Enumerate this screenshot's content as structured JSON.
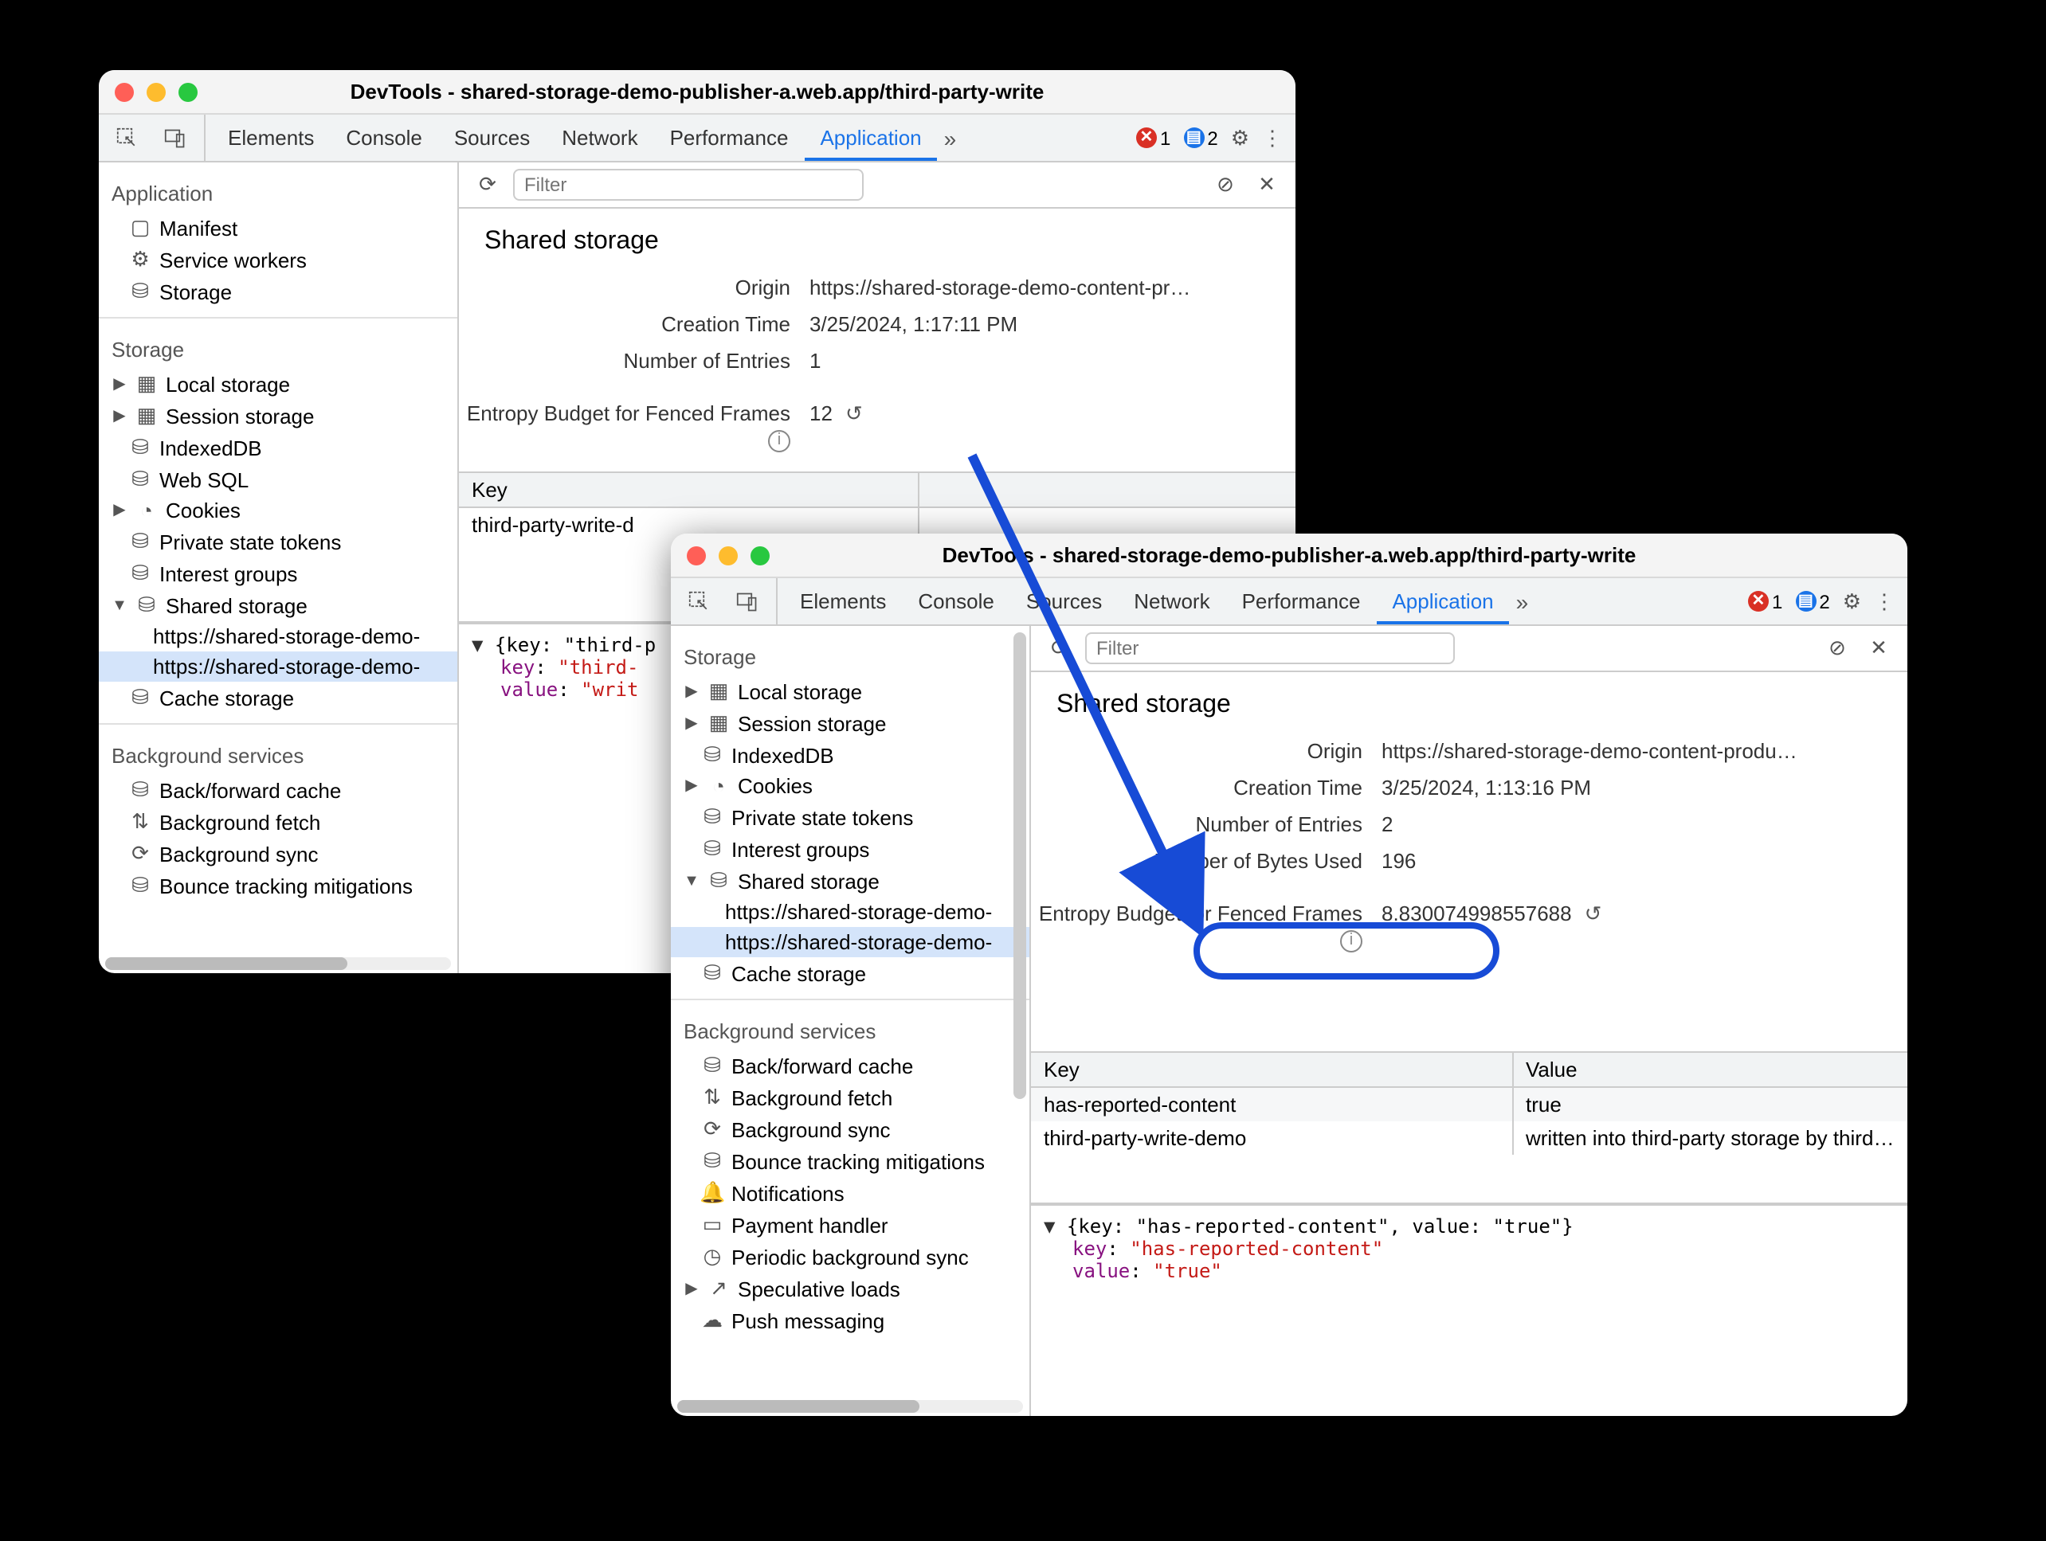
{
  "shared": {
    "title_prefix": "DevTools - ",
    "title_url": "shared-storage-demo-publisher-a.web.app/third-party-write",
    "tabs": {
      "elements": "Elements",
      "console": "Console",
      "sources": "Sources",
      "network": "Network",
      "performance": "Performance",
      "application": "Application"
    },
    "filter_placeholder": "Filter",
    "heading": "Shared storage",
    "origin_label": "Origin",
    "origin_value": "https://shared-storage-demo-content-pr…",
    "origin_value_b": "https://shared-storage-demo-content-produ…",
    "creation_label": "Creation Time",
    "entries_label": "Number of Entries",
    "bytes_label": "Number of Bytes Used",
    "entropy_label": "Entropy Budget for Fenced Frames",
    "table_key": "Key",
    "table_value": "Value",
    "errors": "1",
    "infos": "2",
    "sidebar": {
      "application": "Application",
      "manifest": "Manifest",
      "service_workers": "Service workers",
      "storage": "Storage",
      "storage_section": "Storage",
      "local": "Local storage",
      "session": "Session storage",
      "indexed": "IndexedDB",
      "websql": "Web SQL",
      "cookies": "Cookies",
      "pst": "Private state tokens",
      "ig": "Interest groups",
      "shared": "Shared storage",
      "shared_origin": "https://shared-storage-demo-",
      "cache": "Cache storage",
      "bg_section": "Background services",
      "bf": "Back/forward cache",
      "bgfetch": "Background fetch",
      "bgsync": "Background sync",
      "bounce": "Bounce tracking mitigations",
      "notif": "Notifications",
      "payment": "Payment handler",
      "periodic": "Periodic background sync",
      "spec": "Speculative loads",
      "push": "Push messaging"
    }
  },
  "windowA": {
    "creation_value": "3/25/2024, 1:17:11 PM",
    "entries_value": "1",
    "entropy_value": "12",
    "table_rows": [
      {
        "key": "third-party-write-d"
      }
    ],
    "obj_head": "{key: \"third-p",
    "obj_key_lbl": "key",
    "obj_key_val": "\"third-",
    "obj_val_lbl": "value",
    "obj_val_val": "\"writ"
  },
  "windowB": {
    "creation_value": "3/25/2024, 1:13:16 PM",
    "entries_value": "2",
    "bytes_value": "196",
    "entropy_value": "8.830074998557688",
    "table_rows": [
      {
        "key": "has-reported-content",
        "value": "true"
      },
      {
        "key": "third-party-write-demo",
        "value": "written into third-party storage by third-…"
      }
    ],
    "obj_head": "{key: \"has-reported-content\", value: \"true\"}",
    "obj_key_lbl": "key",
    "obj_key_val": "\"has-reported-content\"",
    "obj_val_lbl": "value",
    "obj_val_val": "\"true\""
  }
}
